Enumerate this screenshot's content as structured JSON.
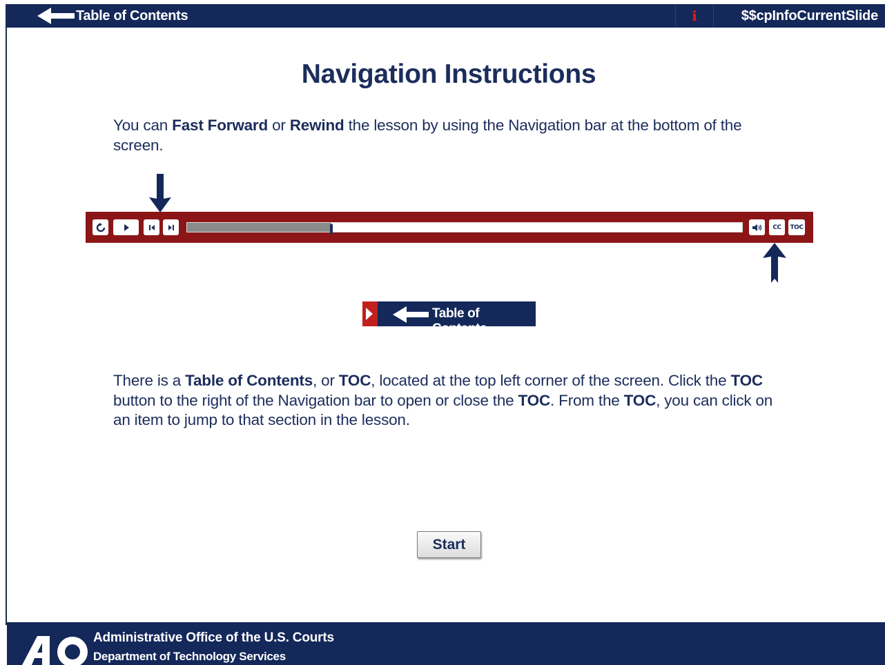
{
  "topbar": {
    "toc_label": "Table of Contents",
    "info_glyph": "i",
    "slide_variable": "$$cpInfoCurrentSlide"
  },
  "page": {
    "title": "Navigation Instructions"
  },
  "paragraph1": {
    "t1": "You can ",
    "b1": "Fast Forward",
    "t2": " or ",
    "b2": "Rewind",
    "t3": " the lesson by using the Navigation bar at the bottom of the screen."
  },
  "navbar": {
    "progress_fraction": 0.26,
    "buttons": {
      "rewind_icon": "refresh-icon",
      "play_icon": "play-icon",
      "prev_icon": "skip-back-icon",
      "next_icon": "skip-forward-icon",
      "audio_icon": "speaker-icon",
      "cc_label": "CC",
      "toc_label": "TOC"
    }
  },
  "toc_sample": {
    "label": "Table of Contents"
  },
  "paragraph2": {
    "t1": "There is a ",
    "b1": "Table of Contents",
    "t2": ", or ",
    "b2": "TOC",
    "t3": ", located at the top left corner of the screen. Click the ",
    "b3": "TOC",
    "t4": " button to the right of the Navigation bar to open or close the ",
    "b4": "TOC",
    "t5": ". From the ",
    "b5": "TOC",
    "t6": ", you can click on an item to jump to that section in the lesson."
  },
  "start_button": {
    "label": "Start"
  },
  "footer": {
    "logo_text": "AO",
    "org": "Administrative Office of the U.S. Courts",
    "dept": "Department of Technology Services"
  },
  "colors": {
    "navy": "#14285a",
    "text_navy": "#1c2d5c",
    "nav_red": "#8c1518",
    "accent_red": "#c0201e"
  }
}
